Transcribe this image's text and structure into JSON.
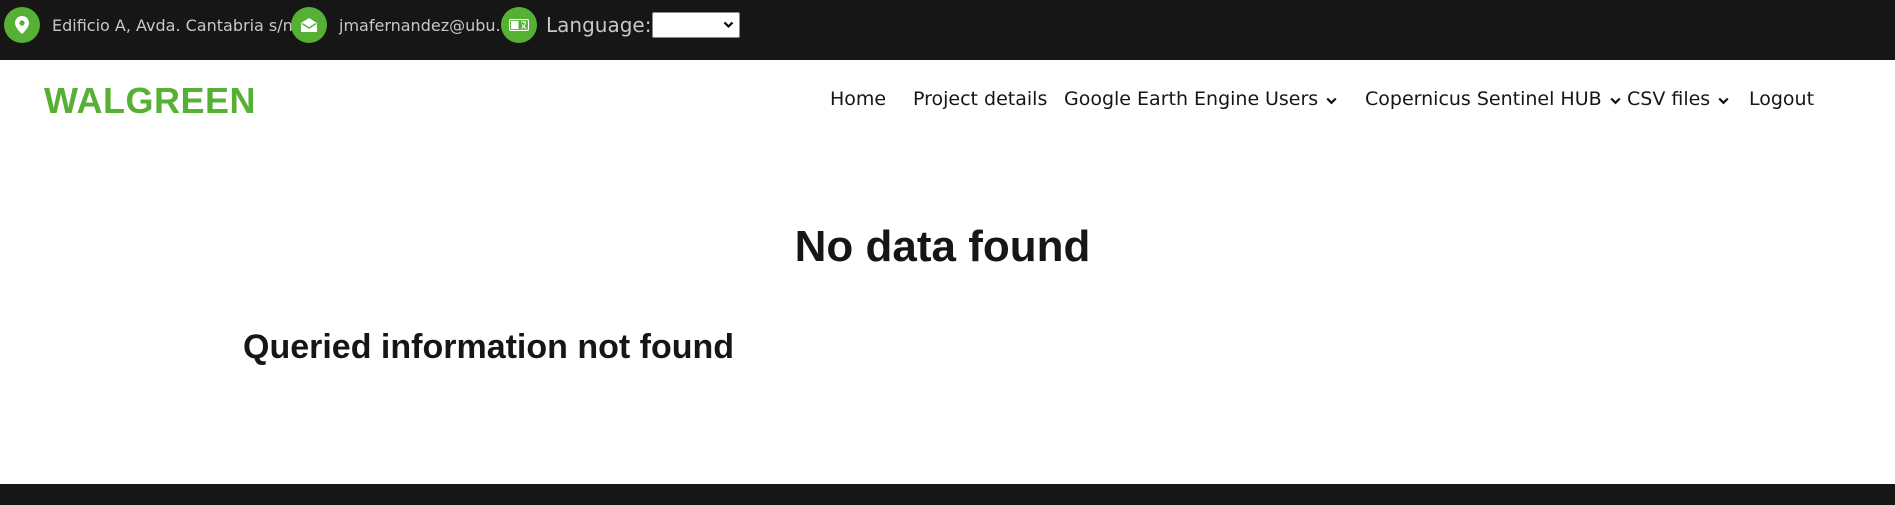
{
  "topbar": {
    "address": "Edificio A, Avda. Cantabria s/n",
    "email": "jmafernandez@ubu.es",
    "language_label": "Language:",
    "language_selected": "",
    "icons": [
      "location-pin-icon",
      "envelope-icon",
      "translate-icon"
    ]
  },
  "header": {
    "brand": "WALGREEN",
    "nav": {
      "home": "Home",
      "project_details": "Project details",
      "google_earth_engine": "Google Earth Engine",
      "users": "Users",
      "copernicus": "Copernicus Sentinel HUB",
      "csv_files": "CSV files",
      "logout": "Logout"
    }
  },
  "main": {
    "title": "No data found",
    "message": "Queried information not found"
  },
  "colors": {
    "accent": "#56b034",
    "topbar_bg": "#161616",
    "footer_bg": "#161616",
    "topbar_text": "#c7c7c7"
  }
}
